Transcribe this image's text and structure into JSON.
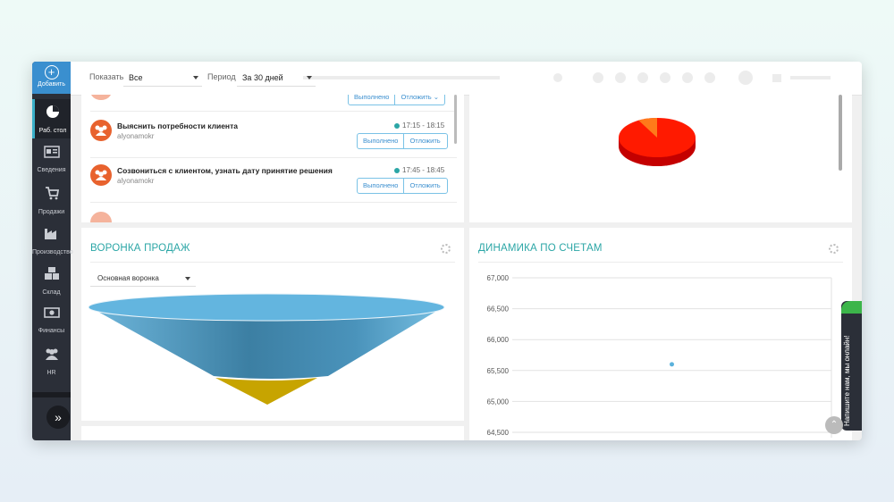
{
  "sidebar": {
    "add_label": "Добавить",
    "items": [
      {
        "label": "Раб. стол",
        "icon": "pie-chart-icon"
      },
      {
        "label": "Сведения",
        "icon": "id-card-icon"
      },
      {
        "label": "Продажи",
        "icon": "cart-icon"
      },
      {
        "label": "Производство",
        "icon": "factory-icon"
      },
      {
        "label": "Склад",
        "icon": "boxes-icon"
      },
      {
        "label": "Финансы",
        "icon": "money-icon"
      },
      {
        "label": "HR",
        "icon": "people-icon"
      }
    ],
    "expand_icon": "double-chevron-right-icon"
  },
  "filters": {
    "show_label": "Показать",
    "show_value": "Все",
    "period_label": "Период",
    "period_value": "За 30 дней"
  },
  "tasks": {
    "done_label": "Выполнено",
    "postpone_label": "Отложить",
    "items": [
      {
        "title": "Выяснить потребности клиента",
        "user": "alyonamokr",
        "time": "17:15 - 18:15"
      },
      {
        "title": "Созвониться с клиентом, узнать дату принятие решения",
        "user": "alyonamokr",
        "time": "17:45 - 18:45"
      }
    ]
  },
  "pie_chart": {
    "colors": [
      "#ff1a00",
      "#ff7a1a"
    ],
    "slices": [
      92,
      8
    ]
  },
  "funnel": {
    "title": "ВОРОНКА ПРОДАЖ",
    "select_value": "Основная воронка",
    "colors": [
      "#5bb2dc",
      "#c8a800"
    ]
  },
  "invoices": {
    "title": "ДИНАМИКА ПО СЧЕТАМ"
  },
  "chart_data": {
    "type": "scatter",
    "title": "ДИНАМИКА ПО СЧЕТАМ",
    "yticks": [
      "67,000",
      "66,500",
      "66,000",
      "65,500",
      "65,000",
      "64,500"
    ],
    "ylim": [
      64500,
      67000
    ],
    "points": [
      {
        "x": 0.5,
        "y": 65600
      }
    ],
    "grid": true,
    "color": "#5bb2dc"
  },
  "chat": {
    "label": "Напишите нам, мы онлайн!"
  }
}
